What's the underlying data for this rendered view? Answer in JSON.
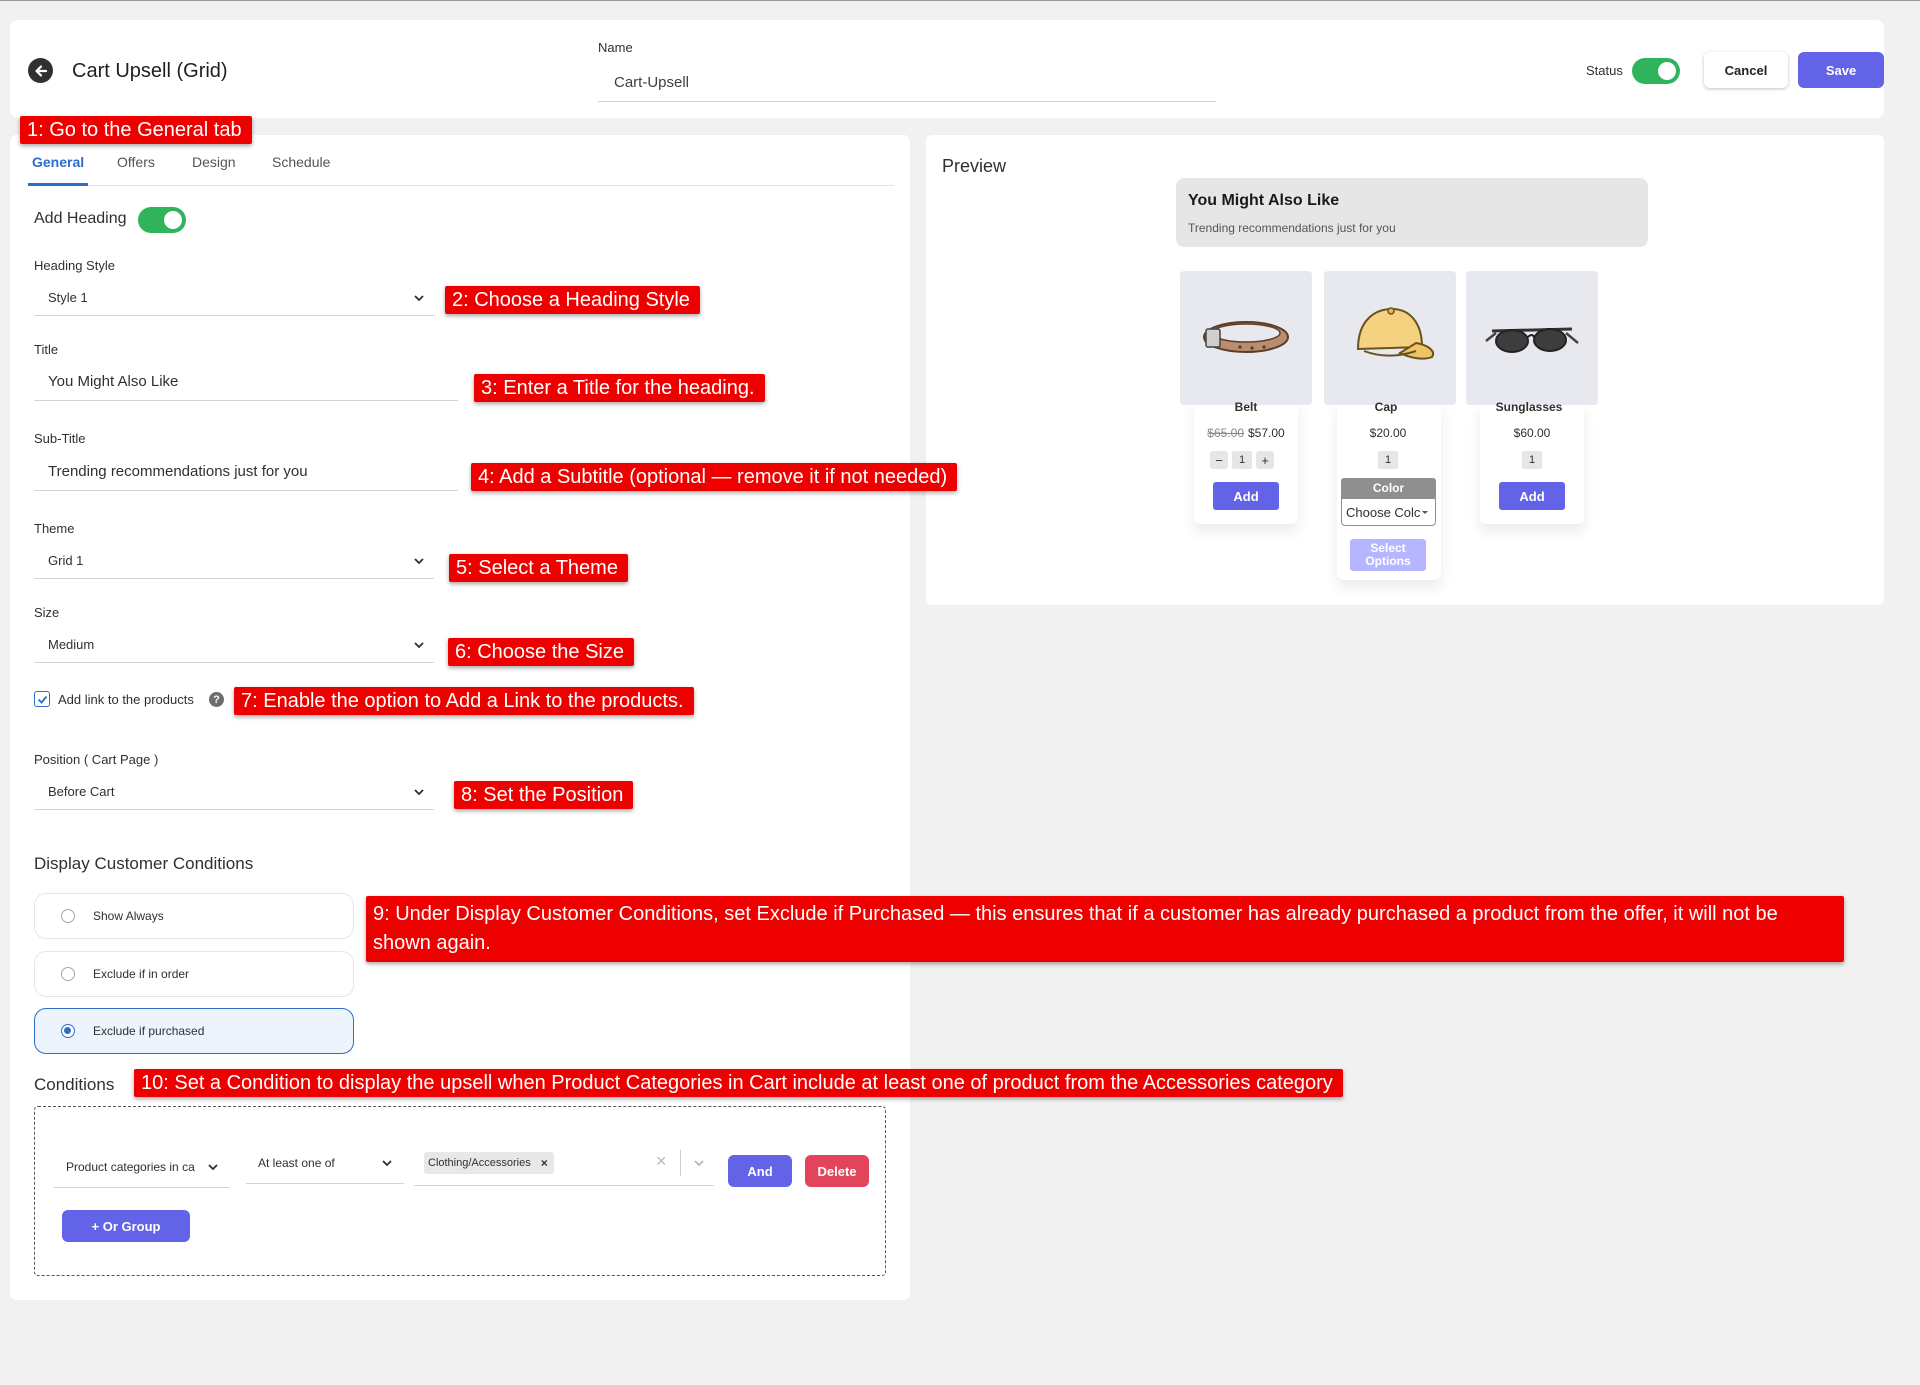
{
  "header": {
    "title": "Cart Upsell (Grid)",
    "name_label": "Name",
    "name_value": "Cart-Upsell",
    "status_label": "Status",
    "status_on": true,
    "cancel_label": "Cancel",
    "save_label": "Save"
  },
  "tabs": [
    {
      "label": "General",
      "active": true
    },
    {
      "label": "Offers"
    },
    {
      "label": "Design"
    },
    {
      "label": "Schedule"
    }
  ],
  "general": {
    "add_heading_label": "Add Heading",
    "add_heading_on": true,
    "heading_style_label": "Heading Style",
    "heading_style_value": "Style 1",
    "title_label": "Title",
    "title_value": "You Might Also Like",
    "subtitle_label": "Sub-Title",
    "subtitle_value": "Trending recommendations just for you",
    "theme_label": "Theme",
    "theme_value": "Grid 1",
    "size_label": "Size",
    "size_value": "Medium",
    "add_link_label": "Add link to the products",
    "add_link_checked": true,
    "help_glyph": "?",
    "position_label": "Position ( Cart Page )",
    "position_value": "Before Cart",
    "display_conditions_title": "Display Customer Conditions",
    "radio_options": [
      "Show Always",
      "Exclude if in order",
      "Exclude if purchased"
    ],
    "radio_selected": "Exclude if purchased",
    "conditions_title": "Conditions",
    "condition_field": "Product categories in ca",
    "condition_operator": "At least one of",
    "condition_tag": "Clothing/Accessories",
    "tag_remove": "×",
    "clear_glyph": "×",
    "and_label": "And",
    "delete_label": "Delete",
    "or_group_label": "+ Or Group"
  },
  "preview": {
    "title": "Preview",
    "heading_title": "You Might Also Like",
    "heading_subtitle": "Trending recommendations just for you",
    "products": [
      {
        "name": "Belt",
        "compare_price": "$65.00",
        "price": "$57.00",
        "qty": "1",
        "add_label": "Add"
      },
      {
        "name": "Cap",
        "price": "$20.00",
        "qty": "1",
        "color_label": "Color",
        "color_placeholder": "Choose Colc",
        "select_label": "Select Options"
      },
      {
        "name": "Sunglasses",
        "price": "$60.00",
        "qty": "1",
        "add_label": "Add"
      }
    ],
    "qty_minus": "−",
    "qty_plus": "+"
  },
  "annotations": [
    "1: Go to the General tab",
    "2: Choose a Heading Style",
    "3: Enter a Title for the heading.",
    "4: Add a Subtitle (optional — remove it if not needed)",
    "5: Select a Theme",
    "6: Choose the Size",
    "7: Enable the option to Add a Link to the products.",
    "8: Set the Position",
    "9: Under Display Customer Conditions, set Exclude if Purchased — this ensures that if a customer has already purchased a product from the offer, it will not be shown again.",
    "10: Set a Condition to display the upsell when Product Categories in Cart include at least one of product from the Accessories category"
  ],
  "colors": {
    "accent": "#6263e6",
    "toggle_on": "#2fb45b",
    "delete": "#e2445c",
    "tab_active": "#2c6ecb",
    "annotation": "#ee0000"
  }
}
